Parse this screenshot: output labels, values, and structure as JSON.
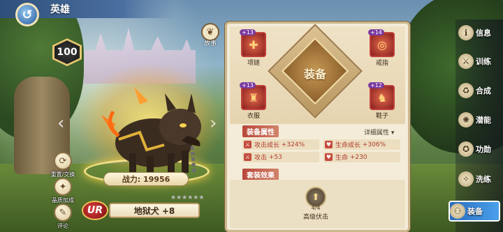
{
  "header": {
    "title": "英雄"
  },
  "hero": {
    "level": "100",
    "power": "战力: 19956",
    "name": "地狱犬 +8",
    "rarity": "UR",
    "stars": "★★★★★★"
  },
  "left_actions": {
    "story": "故事",
    "reset": "重置/交换",
    "talent": "晶质加成",
    "comment": "评论"
  },
  "equipment": {
    "center_label": "装备",
    "slots": [
      {
        "name": "项链",
        "level": "+13"
      },
      {
        "name": "戒指",
        "level": "+14"
      },
      {
        "name": "衣服",
        "level": "+13"
      },
      {
        "name": "鞋子",
        "level": "+12"
      }
    ]
  },
  "attributes": {
    "title": "装备属性",
    "detail": "详细属性",
    "items": [
      {
        "label": "攻击成长",
        "value": "+324%"
      },
      {
        "label": "生命成长",
        "value": "+306%"
      },
      {
        "label": "攻击",
        "value": "+53"
      },
      {
        "label": "生命",
        "value": "+230"
      }
    ]
  },
  "set": {
    "title": "套装效果",
    "count": "4/4",
    "name": "高级伏击"
  },
  "nav": [
    {
      "label": "信息"
    },
    {
      "label": "训练"
    },
    {
      "label": "合成"
    },
    {
      "label": "潜能"
    },
    {
      "label": "功勋"
    },
    {
      "label": "洗练"
    },
    {
      "label": "装备"
    }
  ]
}
